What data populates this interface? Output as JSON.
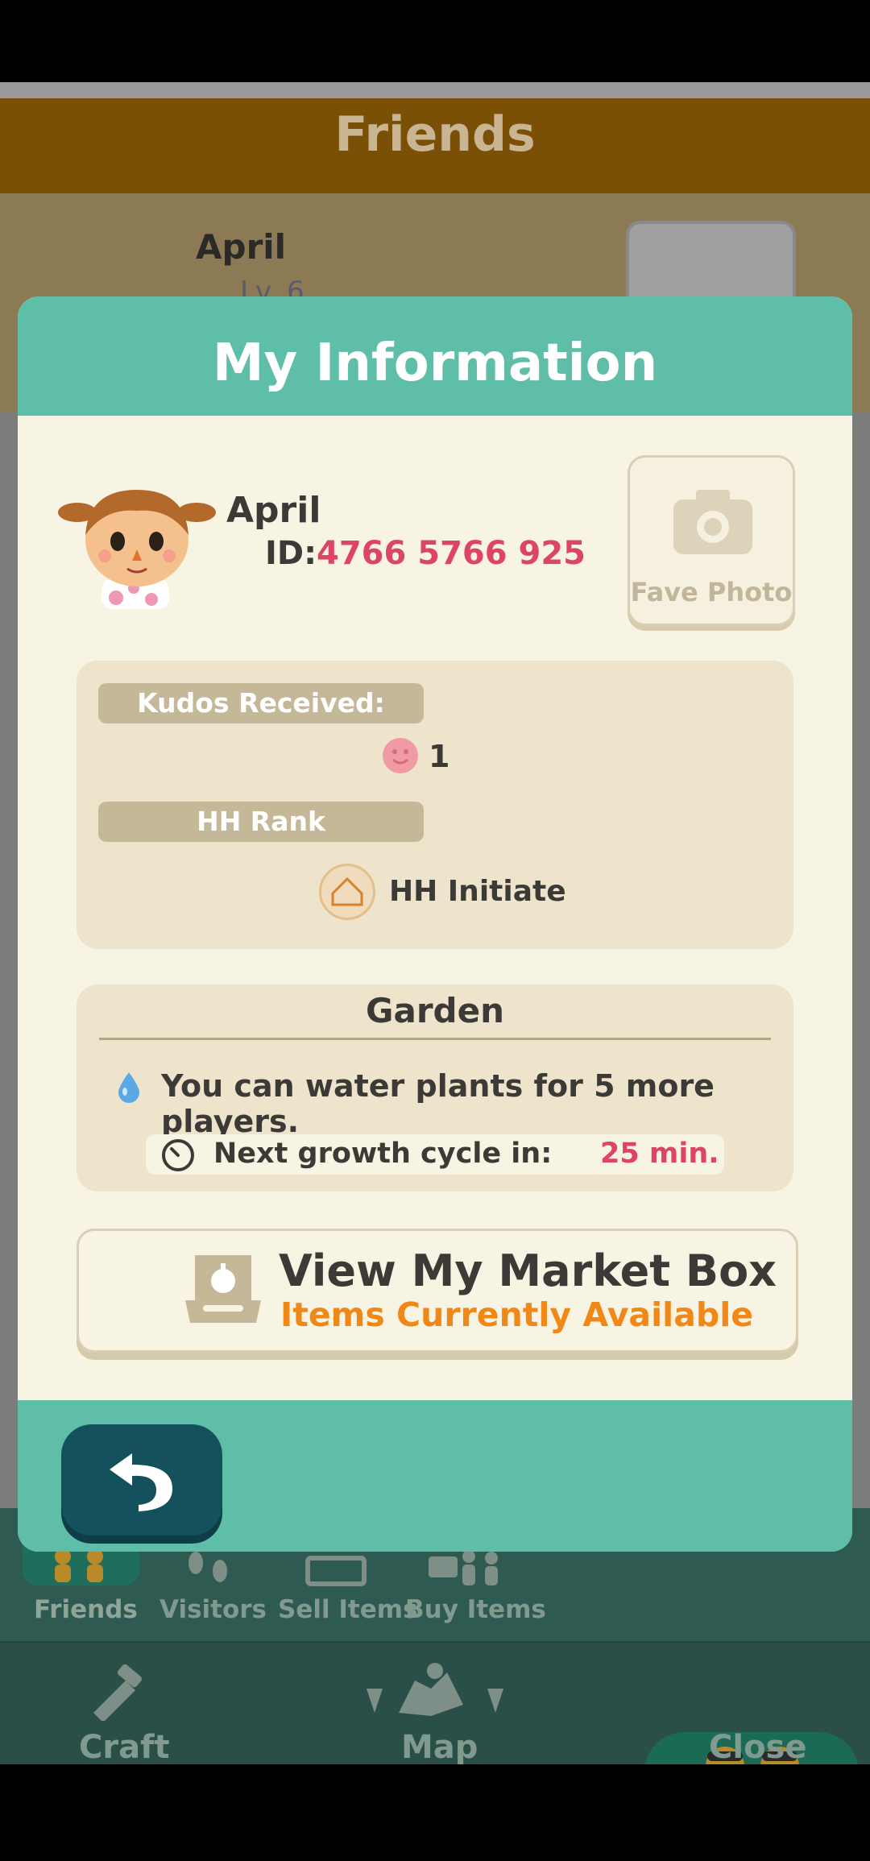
{
  "background": {
    "header_title": "Friends",
    "friend_name": "April",
    "friend_level": "Lv. 6",
    "nav_tabs": [
      {
        "label": "Friends",
        "icon": "friends-icon"
      },
      {
        "label": "Visitors",
        "icon": "footprints-icon"
      },
      {
        "label": "Sell Items",
        "icon": "market-box-icon"
      },
      {
        "label": "Buy Items",
        "icon": "shoppers-icon"
      }
    ],
    "bottom_nav": [
      {
        "label": "Craft",
        "icon": "craft-icon"
      },
      {
        "label": "Map",
        "icon": "map-icon"
      },
      {
        "label": "Close",
        "icon": "two-villagers-icon"
      }
    ]
  },
  "modal": {
    "title": "My Information",
    "user": {
      "name": "April",
      "id_label": "ID:",
      "id_value": "4766 5766 925"
    },
    "fave_photo": {
      "label": "Fave Photo",
      "icon": "camera-icon"
    },
    "kudos": {
      "label": "Kudos Received:",
      "value": "1",
      "icon": "smiley-icon"
    },
    "rank": {
      "label": "HH Rank",
      "value": "HH Initiate",
      "icon": "house-badge-icon"
    },
    "garden": {
      "title": "Garden",
      "water_text": "You can water plants for 5 more players.",
      "cycle_label": "Next growth cycle in:",
      "cycle_value": "25 min."
    },
    "market": {
      "title": "View My Market Box",
      "subtitle": "Items Currently Available",
      "icon": "market-box-icon"
    },
    "back_icon": "back-arrow-icon"
  },
  "colors": {
    "teal": "#5ebea7",
    "cream": "#f8f4e4",
    "accent_red": "#dd4565",
    "accent_orange": "#f08818",
    "back_button": "#15515d"
  }
}
